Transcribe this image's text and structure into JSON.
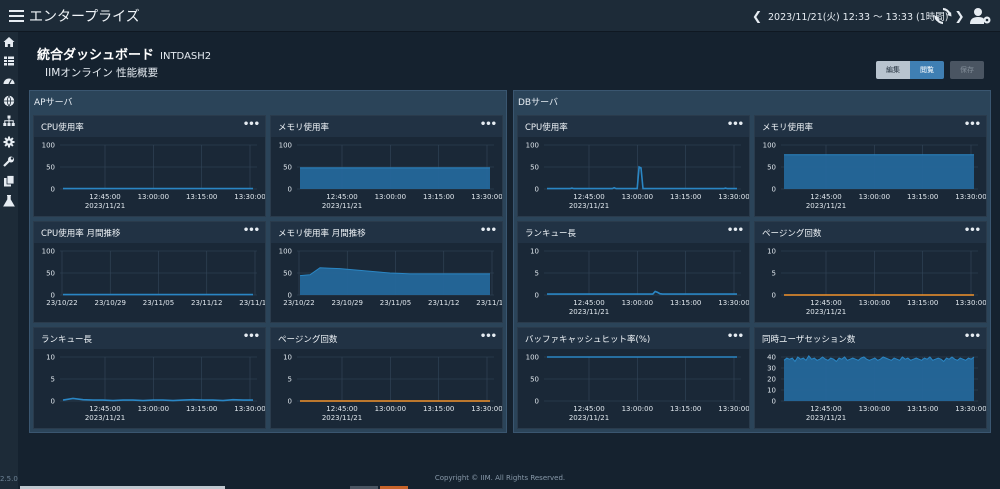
{
  "app": {
    "title": "エンタープライズ",
    "time_range": "2023/11/21(火) 12:33 〜 13:33 (1時間)",
    "version": "2.5.0",
    "footer": "Copyright © IIM. All Rights Reserved."
  },
  "nav_icons": [
    "home-icon",
    "grid-icon",
    "gauge-icon",
    "globe-icon",
    "sitemap-icon",
    "gear-icon",
    "wrench-icon",
    "copy-icon",
    "flask-icon"
  ],
  "page": {
    "title": "統合ダッシュボード",
    "id": "INTDASH2",
    "subtitle": "IIMオンライン 性能概要"
  },
  "buttons": {
    "edit": "編集",
    "view": "閲覧",
    "save": "保存"
  },
  "groups": [
    {
      "title": "APサーバ"
    },
    {
      "title": "DBサーバ"
    }
  ],
  "colors": {
    "series": "#2a86c4",
    "area": "#24679a",
    "orange": "#f2922c",
    "grid": "#34475a"
  },
  "chart_data": [
    {
      "name": "ap-cpu",
      "title": "CPU使用率",
      "type": "line",
      "ylim": [
        0,
        100
      ],
      "yticks": [
        "100",
        "50",
        "0"
      ],
      "xticks": [
        "12:45:00",
        "13:00:00",
        "13:15:00",
        "13:30:00"
      ],
      "date": "2023/11/21",
      "series": [
        {
          "values": [
            1,
            1,
            1,
            1,
            1,
            1,
            1,
            1,
            1,
            1,
            1,
            1,
            1,
            1,
            1,
            1,
            1,
            1,
            1,
            1
          ]
        }
      ]
    },
    {
      "name": "ap-mem",
      "title": "メモリ使用率",
      "type": "area",
      "ylim": [
        0,
        100
      ],
      "yticks": [
        "100",
        "50",
        "0"
      ],
      "xticks": [
        "12:45:00",
        "13:00:00",
        "13:15:00",
        "13:30:00"
      ],
      "date": "2023/11/21",
      "series": [
        {
          "values": [
            48,
            48,
            48,
            48,
            48,
            48,
            48,
            48,
            48,
            48,
            48,
            48,
            48,
            48,
            48,
            48,
            48,
            48,
            48,
            48
          ]
        }
      ]
    },
    {
      "name": "ap-cpu-month",
      "title": "CPU使用率 月間推移",
      "type": "line",
      "ylim": [
        0,
        100
      ],
      "yticks": [
        "100",
        "50",
        "0"
      ],
      "xticks": [
        "23/10/22",
        "23/10/29",
        "23/11/05",
        "23/11/12",
        "23/11/19"
      ],
      "date": "",
      "series": [
        {
          "values": [
            1,
            1,
            1,
            1,
            1,
            1,
            1,
            1,
            1,
            1,
            1,
            1,
            1,
            1,
            1,
            1,
            1,
            1,
            1,
            1
          ]
        }
      ]
    },
    {
      "name": "ap-mem-month",
      "title": "メモリ使用率 月間推移",
      "type": "area",
      "ylim": [
        0,
        100
      ],
      "yticks": [
        "100",
        "50",
        "0"
      ],
      "xticks": [
        "23/10/22",
        "23/10/29",
        "23/11/05",
        "23/11/12",
        "23/11/19"
      ],
      "date": "",
      "series": [
        {
          "values": [
            44,
            46,
            62,
            61,
            60,
            58,
            56,
            54,
            52,
            50,
            49,
            48,
            48,
            48,
            48,
            48,
            48,
            48,
            48,
            48
          ]
        }
      ]
    },
    {
      "name": "ap-runqueue",
      "title": "ランキュー長",
      "type": "line",
      "ylim": [
        0,
        10
      ],
      "yticks": [
        "10",
        "5",
        "0"
      ],
      "xticks": [
        "12:45:00",
        "13:00:00",
        "13:15:00",
        "13:30:00"
      ],
      "date": "2023/11/21",
      "series": [
        {
          "values": [
            0.2,
            0.6,
            0.3,
            0.2,
            0.2,
            0.1,
            0.2,
            0.2,
            0.1,
            0.2,
            0.2,
            0.1,
            0.2,
            0.3,
            0.2,
            0.2,
            0.1,
            0.3,
            0.2,
            0.2
          ]
        }
      ]
    },
    {
      "name": "ap-paging",
      "title": "ページング回数",
      "type": "line",
      "color": "orange",
      "ylim": [
        0,
        10
      ],
      "yticks": [
        "10",
        "5",
        "0"
      ],
      "xticks": [
        "12:45:00",
        "13:00:00",
        "13:15:00",
        "13:30:00"
      ],
      "date": "2023/11/21",
      "series": [
        {
          "values": [
            0,
            0,
            0,
            0,
            0,
            0,
            0,
            0,
            0,
            0,
            0,
            0,
            0,
            0,
            0,
            0,
            0,
            0,
            0,
            0
          ]
        }
      ]
    },
    {
      "name": "db-cpu",
      "title": "CPU使用率",
      "type": "line",
      "ylim": [
        0,
        100
      ],
      "yticks": [
        "100",
        "50",
        "0"
      ],
      "xticks": [
        "12:45:00",
        "13:00:00",
        "13:15:00",
        "13:30:00"
      ],
      "date": "2023/11/21",
      "series": [
        {
          "values": [
            1,
            1,
            1,
            1,
            1,
            1,
            1,
            1,
            1,
            1,
            1,
            1,
            1,
            2,
            1,
            1,
            1,
            1,
            1,
            1,
            1,
            1,
            1,
            1,
            1,
            1,
            1,
            1,
            1,
            1,
            1,
            1,
            1,
            1,
            1,
            3,
            1,
            1,
            1,
            1,
            1,
            1,
            1,
            1,
            1,
            1,
            1,
            1,
            50,
            48,
            1,
            1,
            1,
            1,
            1,
            1,
            1,
            1,
            1,
            1,
            1,
            1,
            1,
            1,
            1,
            1,
            1,
            1,
            1,
            1,
            1,
            1,
            1,
            1,
            1,
            1,
            1,
            1,
            1,
            1,
            1,
            1,
            1,
            1,
            1,
            1,
            1,
            1,
            1,
            1,
            1,
            1,
            1,
            2,
            1,
            1,
            1,
            1,
            1,
            1
          ]
        }
      ]
    },
    {
      "name": "db-mem",
      "title": "メモリ使用率",
      "type": "area",
      "ylim": [
        0,
        100
      ],
      "yticks": [
        "100",
        "50",
        "0"
      ],
      "xticks": [
        "12:45:00",
        "13:00:00",
        "13:15:00",
        "13:30:00"
      ],
      "date": "2023/11/21",
      "series": [
        {
          "values": [
            78,
            78,
            78,
            78,
            78,
            78,
            78,
            78,
            78,
            78,
            78,
            78,
            78,
            78,
            78,
            78,
            78,
            78,
            78,
            78
          ]
        }
      ]
    },
    {
      "name": "db-runqueue",
      "title": "ランキュー長",
      "type": "line",
      "ylim": [
        0,
        10
      ],
      "yticks": [
        "10",
        "5",
        "0"
      ],
      "xticks": [
        "12:45:00",
        "13:00:00",
        "13:15:00",
        "13:30:00"
      ],
      "date": "2023/11/21",
      "series": [
        {
          "values": [
            0.2,
            0.2,
            0.2,
            0.2,
            0.2,
            0.2,
            0.2,
            0.2,
            0.2,
            0.2,
            0.2,
            0.2,
            0.2,
            0.2,
            0.2,
            0.2,
            0.2,
            0.2,
            0.2,
            0.2,
            0.2,
            0.2,
            0.2,
            0.2,
            0.2,
            0.2,
            0.2,
            0.2,
            0.2,
            0.2,
            0.2,
            0.2,
            0.2,
            0.2,
            0.2,
            0.2,
            0.2,
            0.2,
            0.2,
            0.2,
            0.2,
            0.2,
            0.2,
            0.2,
            0.2,
            0.8,
            0.6,
            0.3,
            0.2,
            0.2,
            0.2,
            0.2,
            0.2,
            0.2,
            0.2,
            0.2,
            0.2,
            0.2,
            0.2,
            0.2,
            0.2,
            0.2,
            0.2,
            0.2,
            0.2,
            0.2,
            0.2,
            0.2,
            0.2,
            0.2,
            0.2,
            0.2,
            0.2,
            0.2,
            0.2,
            0.2,
            0.2,
            0.2,
            0.2,
            0.2
          ]
        }
      ]
    },
    {
      "name": "db-paging",
      "title": "ページング回数",
      "type": "line",
      "color": "orange",
      "ylim": [
        0,
        10
      ],
      "yticks": [
        "10",
        "5",
        "0"
      ],
      "xticks": [
        "12:45:00",
        "13:00:00",
        "13:15:00",
        "13:30:00"
      ],
      "date": "2023/11/21",
      "series": [
        {
          "values": [
            0,
            0,
            0,
            0,
            0,
            0,
            0,
            0,
            0,
            0,
            0,
            0,
            0,
            0,
            0,
            0,
            0,
            0,
            0,
            0
          ]
        }
      ]
    },
    {
      "name": "db-buffer-hit",
      "title": "バッファキャッシュヒット率(%)",
      "type": "line",
      "ylim": [
        0,
        100
      ],
      "yticks": [
        "100",
        "50",
        "0"
      ],
      "xticks": [
        "12:45:00",
        "13:00:00",
        "13:15:00",
        "13:30:00"
      ],
      "date": "2023/11/21",
      "series": [
        {
          "values": [
            100,
            100,
            100,
            100,
            100,
            100,
            100,
            100,
            100,
            100,
            100,
            100,
            100,
            100,
            100,
            100,
            100,
            100,
            100,
            100
          ]
        }
      ]
    },
    {
      "name": "db-sessions",
      "title": "同時ユーザセッション数",
      "type": "area",
      "ylim": [
        0,
        40
      ],
      "yticks": [
        "40",
        "30",
        "20",
        "10",
        "0"
      ],
      "xticks": [
        "12:45:00",
        "13:00:00",
        "13:15:00",
        "13:30:00"
      ],
      "date": "2023/11/21",
      "series": [
        {
          "values": [
            37,
            39,
            38,
            39,
            36,
            40,
            38,
            39,
            37,
            41,
            38,
            39,
            37,
            38,
            40,
            38,
            37,
            39,
            38,
            36,
            39,
            38,
            40,
            37,
            38,
            39,
            38,
            37,
            39,
            40,
            38,
            37,
            38,
            39,
            37,
            38,
            40,
            39,
            38,
            37,
            39,
            38,
            37,
            40,
            38,
            39,
            37,
            38,
            39,
            38,
            37,
            39,
            38,
            40,
            37,
            38,
            39,
            38,
            36,
            39,
            38,
            40,
            38,
            37,
            39,
            38,
            37,
            39,
            38,
            40
          ]
        }
      ]
    }
  ]
}
